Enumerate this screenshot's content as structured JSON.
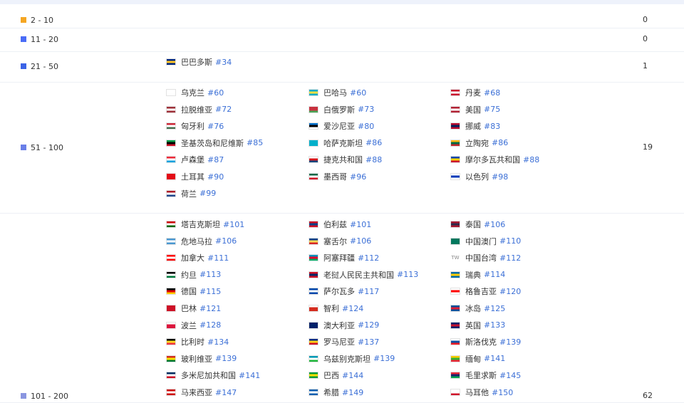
{
  "groups": [
    {
      "id": "g1",
      "label": "2 - 10",
      "color": "#f5a623",
      "count": "0",
      "countries": []
    },
    {
      "id": "g2",
      "label": "11 - 20",
      "color": "#4a6cf7",
      "count": "0",
      "countries": []
    },
    {
      "id": "g3",
      "label": "21 - 50",
      "color": "#3b63e6",
      "count": "1",
      "countries": [
        {
          "name": "巴巴多斯",
          "rank": "#34",
          "flag": [
            "#00267f",
            "#ffc726",
            "#00267f"
          ]
        }
      ]
    },
    {
      "id": "g4",
      "label": "51 - 100",
      "color": "#6a7fe8",
      "count": "19",
      "countries": [
        {
          "name": "乌克兰",
          "rank": "#60",
          "flag": [
            "#0057b7",
            "#ffd700"
          ]
        },
        {
          "name": "巴哈马",
          "rank": "#60",
          "flag": [
            "#00abc9",
            "#fae042",
            "#00abc9"
          ]
        },
        {
          "name": "丹麦",
          "rank": "#68",
          "flag": [
            "#c8102e",
            "#ffffff",
            "#c8102e"
          ]
        },
        {
          "name": "拉脱维亚",
          "rank": "#72",
          "flag": [
            "#9e3039",
            "#ffffff",
            "#9e3039"
          ]
        },
        {
          "name": "白俄罗斯",
          "rank": "#73",
          "flag": [
            "#c8313e",
            "#c8313e",
            "#4aa657"
          ]
        },
        {
          "name": "美国",
          "rank": "#75",
          "flag": [
            "#b22234",
            "#ffffff",
            "#b22234"
          ]
        },
        {
          "name": "匈牙利",
          "rank": "#76",
          "flag": [
            "#ce2939",
            "#ffffff",
            "#477050"
          ]
        },
        {
          "name": "爱沙尼亚",
          "rank": "#80",
          "flag": [
            "#0072ce",
            "#000000",
            "#ffffff"
          ]
        },
        {
          "name": "挪威",
          "rank": "#83",
          "flag": [
            "#ba0c2f",
            "#00205b",
            "#ba0c2f"
          ]
        },
        {
          "name": "圣基茨岛和尼维斯",
          "rank": "#85",
          "flag": [
            "#009e49",
            "#000000",
            "#ce1126"
          ]
        },
        {
          "name": "哈萨克斯坦",
          "rank": "#86",
          "flag": [
            "#00afca",
            "#00afca",
            "#00afca"
          ]
        },
        {
          "name": "立陶宛",
          "rank": "#86",
          "flag": [
            "#fdb913",
            "#006a44",
            "#c1272d"
          ]
        },
        {
          "name": "卢森堡",
          "rank": "#87",
          "flag": [
            "#ed2939",
            "#ffffff",
            "#00a1de"
          ]
        },
        {
          "name": "捷克共和国",
          "rank": "#88",
          "flag": [
            "#ffffff",
            "#d7141a",
            "#11457e"
          ]
        },
        {
          "name": "摩尔多瓦共和国",
          "rank": "#88",
          "flag": [
            "#0046ae",
            "#ffd200",
            "#cc092f"
          ]
        },
        {
          "name": "土耳其",
          "rank": "#90",
          "flag": [
            "#e30a17",
            "#e30a17",
            "#e30a17"
          ]
        },
        {
          "name": "墨西哥",
          "rank": "#96",
          "flag": [
            "#006847",
            "#ffffff",
            "#ce1126"
          ]
        },
        {
          "name": "以色列",
          "rank": "#98",
          "flag": [
            "#ffffff",
            "#0038b8",
            "#ffffff"
          ]
        },
        {
          "name": "荷兰",
          "rank": "#99",
          "flag": [
            "#ae1c28",
            "#ffffff",
            "#21468b"
          ]
        }
      ]
    },
    {
      "id": "g5",
      "label": "101 - 200",
      "color": "#8a96e0",
      "count": "62",
      "countries": [
        {
          "name": "塔吉克斯坦",
          "rank": "#101",
          "flag": [
            "#cc0000",
            "#ffffff",
            "#006600"
          ]
        },
        {
          "name": "伯利兹",
          "rank": "#101",
          "flag": [
            "#ce1126",
            "#003f87",
            "#ce1126"
          ]
        },
        {
          "name": "泰国",
          "rank": "#106",
          "flag": [
            "#a51931",
            "#2d2a4a",
            "#a51931"
          ]
        },
        {
          "name": "危地马拉",
          "rank": "#106",
          "flag": [
            "#4997d0",
            "#ffffff",
            "#4997d0"
          ]
        },
        {
          "name": "塞舌尔",
          "rank": "#106",
          "flag": [
            "#003f87",
            "#fcd856",
            "#d62828"
          ]
        },
        {
          "name": "中国澳门",
          "rank": "#110",
          "flag": [
            "#00785e",
            "#00785e",
            "#00785e"
          ]
        },
        {
          "name": "加拿大",
          "rank": "#111",
          "flag": [
            "#ff0000",
            "#ffffff",
            "#ff0000"
          ]
        },
        {
          "name": "阿塞拜疆",
          "rank": "#112",
          "flag": [
            "#0092bc",
            "#e4002b",
            "#00af66"
          ]
        },
        {
          "name": "中国台湾",
          "rank": "#112",
          "flag": [
            "#ffffff",
            "#ffffff",
            "#ffffff"
          ],
          "tw": "TW"
        },
        {
          "name": "约旦",
          "rank": "#113",
          "flag": [
            "#000000",
            "#ffffff",
            "#007a3d"
          ]
        },
        {
          "name": "老挝人民民主共和国",
          "rank": "#113",
          "flag": [
            "#ce1126",
            "#002868",
            "#ce1126"
          ]
        },
        {
          "name": "瑞典",
          "rank": "#114",
          "flag": [
            "#006aa7",
            "#fecc00",
            "#006aa7"
          ]
        },
        {
          "name": "德国",
          "rank": "#115",
          "flag": [
            "#000000",
            "#dd0000",
            "#ffce00"
          ]
        },
        {
          "name": "萨尔瓦多",
          "rank": "#117",
          "flag": [
            "#0047ab",
            "#ffffff",
            "#0047ab"
          ]
        },
        {
          "name": "格鲁吉亚",
          "rank": "#120",
          "flag": [
            "#ffffff",
            "#ff0000",
            "#ffffff"
          ]
        },
        {
          "name": "巴林",
          "rank": "#121",
          "flag": [
            "#ce1126",
            "#ce1126",
            "#ce1126"
          ]
        },
        {
          "name": "智利",
          "rank": "#124",
          "flag": [
            "#ffffff",
            "#d52b1e",
            "#d52b1e"
          ]
        },
        {
          "name": "冰岛",
          "rank": "#125",
          "flag": [
            "#02529c",
            "#dc1e35",
            "#02529c"
          ]
        },
        {
          "name": "波兰",
          "rank": "#128",
          "flag": [
            "#ffffff",
            "#dc143c",
            "#dc143c"
          ]
        },
        {
          "name": "澳大利亚",
          "rank": "#129",
          "flag": [
            "#012169",
            "#012169",
            "#012169"
          ]
        },
        {
          "name": "英国",
          "rank": "#133",
          "flag": [
            "#012169",
            "#c8102e",
            "#012169"
          ]
        },
        {
          "name": "比利时",
          "rank": "#134",
          "flag": [
            "#000000",
            "#fdda24",
            "#ef3340"
          ]
        },
        {
          "name": "罗马尼亚",
          "rank": "#137",
          "flag": [
            "#002b7f",
            "#fcd116",
            "#ce1126"
          ]
        },
        {
          "name": "斯洛伐克",
          "rank": "#139",
          "flag": [
            "#ffffff",
            "#0b4ea2",
            "#ee1c25"
          ]
        },
        {
          "name": "玻利维亚",
          "rank": "#139",
          "flag": [
            "#d52b1e",
            "#f9e300",
            "#007934"
          ]
        },
        {
          "name": "乌兹别克斯坦",
          "rank": "#139",
          "flag": [
            "#0099b5",
            "#ffffff",
            "#1eb53a"
          ]
        },
        {
          "name": "缅甸",
          "rank": "#141",
          "flag": [
            "#fecb00",
            "#34b233",
            "#ea2839"
          ]
        },
        {
          "name": "多米尼加共和国",
          "rank": "#141",
          "flag": [
            "#002d62",
            "#ffffff",
            "#ce1126"
          ]
        },
        {
          "name": "巴西",
          "rank": "#144",
          "flag": [
            "#009c3b",
            "#ffdf00",
            "#009c3b"
          ]
        },
        {
          "name": "毛里求斯",
          "rank": "#145",
          "flag": [
            "#ea2839",
            "#1a206d",
            "#00a551"
          ]
        },
        {
          "name": "马来西亚",
          "rank": "#147",
          "flag": [
            "#cc0001",
            "#ffffff",
            "#cc0001"
          ]
        },
        {
          "name": "希腊",
          "rank": "#149",
          "flag": [
            "#0d5eaf",
            "#ffffff",
            "#0d5eaf"
          ]
        },
        {
          "name": "马耳他",
          "rank": "#150",
          "flag": [
            "#ffffff",
            "#ffffff",
            "#cf142b"
          ]
        }
      ]
    }
  ]
}
